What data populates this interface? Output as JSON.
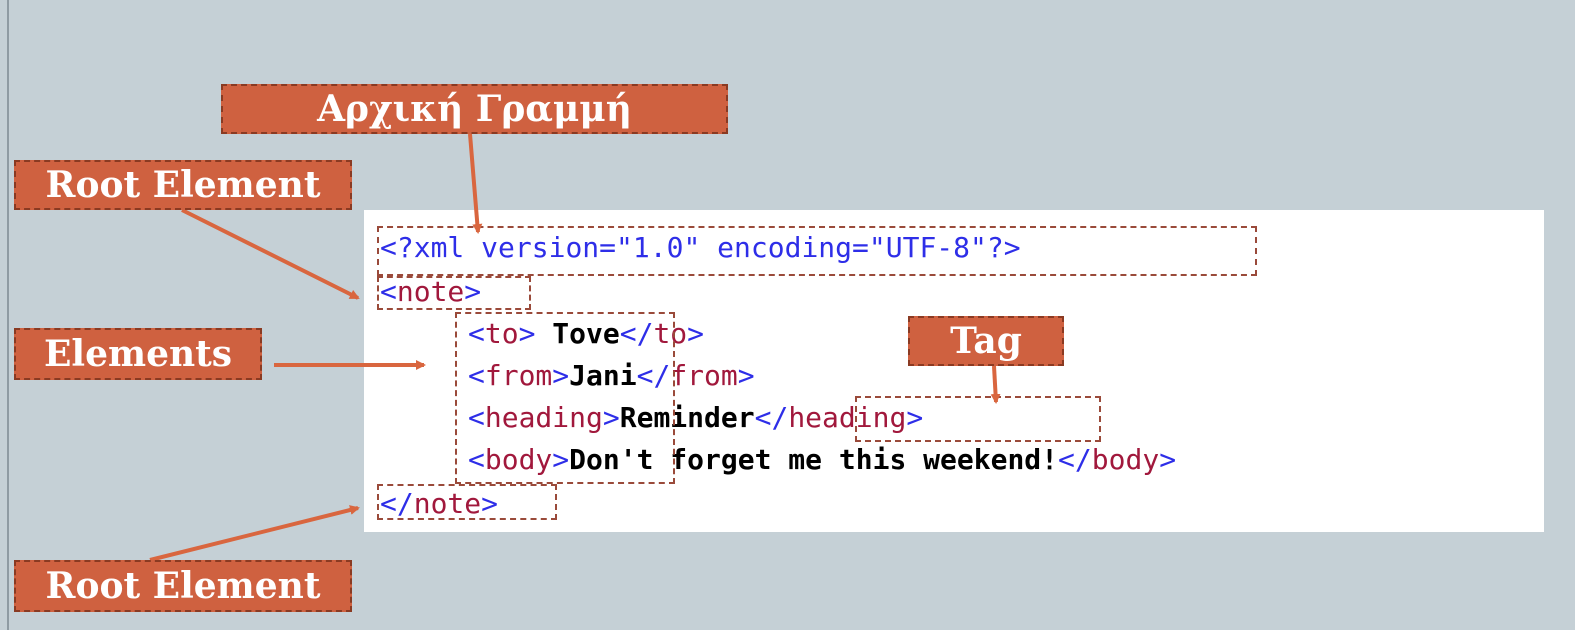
{
  "labels": {
    "first_line": "Αρχική Γραμμή",
    "root_element_top": "Root Element",
    "elements": "Elements",
    "tag": "Tag",
    "root_element_bottom": "Root Element"
  },
  "code": {
    "line1": {
      "open": "<?",
      "name": "xml",
      "rest": " version=\"1.0\" encoding=\"UTF-8\"?>"
    },
    "line2": {
      "open": "<",
      "name": "note",
      "close": ">"
    },
    "line3": {
      "o1": "<",
      "n1": "to",
      "c1": ">",
      "text": " Tove",
      "o2": "</",
      "n2": "to",
      "c2": ">"
    },
    "line4": {
      "o1": "<",
      "n1": "from",
      "c1": ">",
      "text": "Jani",
      "o2": "</",
      "n2": "from",
      "c2": ">"
    },
    "line5": {
      "o1": "<",
      "n1": "heading",
      "c1": ">",
      "text": "Reminder",
      "o2": "</",
      "n2": "heading",
      "c2": ">"
    },
    "line6": {
      "o1": "<",
      "n1": "body",
      "c1": ">",
      "text": "Don't forget me this weekend!",
      "o2": "</",
      "n2": "body",
      "c2": ">"
    },
    "line7": {
      "open": "</",
      "name": "note",
      "close": ">"
    }
  },
  "colors": {
    "background": "#c5d0d6",
    "label_fill": "#cf6140",
    "arrow": "#d9663f",
    "tag_bracket": "#2e2ee8",
    "tag_name": "#a1183c"
  }
}
